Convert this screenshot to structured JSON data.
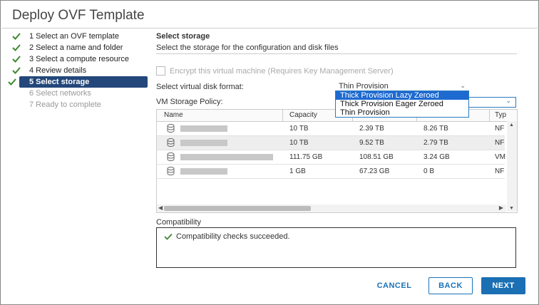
{
  "window": {
    "title": "Deploy OVF Template"
  },
  "steps": [
    {
      "label": "1 Select an OVF template",
      "state": "done"
    },
    {
      "label": "2 Select a name and folder",
      "state": "done"
    },
    {
      "label": "3 Select a compute resource",
      "state": "done"
    },
    {
      "label": "4 Review details",
      "state": "done"
    },
    {
      "label": "5 Select storage",
      "state": "active"
    },
    {
      "label": "6 Select networks",
      "state": "future"
    },
    {
      "label": "7 Ready to complete",
      "state": "future"
    }
  ],
  "section": {
    "title": "Select storage",
    "subtitle": "Select the storage for the configuration and disk files"
  },
  "encrypt": {
    "label": "Encrypt this virtual machine (Requires Key Management Server)",
    "checked": false
  },
  "disk_format": {
    "label": "Select virtual disk format:",
    "value": "Thin Provision",
    "options": [
      "Thick Provision Lazy Zeroed",
      "Thick Provision Eager Zeroed",
      "Thin Provision"
    ],
    "highlighted": "Thick Provision Lazy Zeroed"
  },
  "storage_policy": {
    "label": "VM Storage Policy:"
  },
  "table": {
    "columns": [
      "Name",
      "Capacity",
      "",
      "",
      "Typ"
    ],
    "rows": [
      {
        "name": "",
        "capacity": "10 TB",
        "provisioned": "2.39 TB",
        "free": "8.26 TB",
        "type": "NF"
      },
      {
        "name": "",
        "capacity": "10 TB",
        "provisioned": "9.52 TB",
        "free": "2.79 TB",
        "type": "NF"
      },
      {
        "name": "",
        "capacity": "111.75 GB",
        "provisioned": "108.51 GB",
        "free": "3.24 GB",
        "type": "VM"
      },
      {
        "name": "",
        "capacity": "1 GB",
        "provisioned": "67.23 GB",
        "free": "0 B",
        "type": "NF"
      }
    ]
  },
  "compatibility": {
    "label": "Compatibility",
    "message": "Compatibility checks succeeded."
  },
  "buttons": {
    "cancel": "CANCEL",
    "back": "BACK",
    "next": "NEXT"
  },
  "colors": {
    "accent": "#1b6fb3",
    "active_step": "#23477a",
    "check": "#3c8a2e"
  }
}
